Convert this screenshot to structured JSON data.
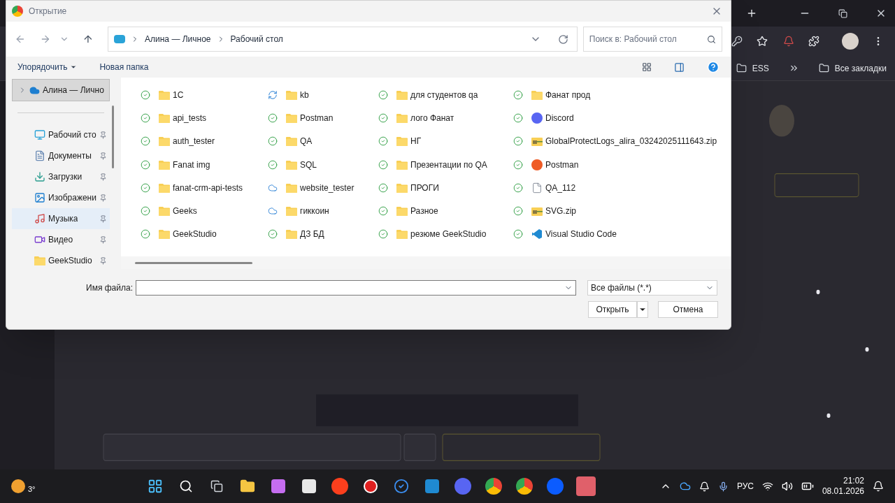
{
  "dialog": {
    "title": "Открытие",
    "breadcrumb": [
      "Алина — Личное",
      "Рабочий стол"
    ],
    "search_placeholder": "Поиск в: Рабочий стол",
    "toolbar": [
      "Упорядочить",
      "Новая папка"
    ],
    "sidebar": {
      "root": {
        "label": "Алина — Лично",
        "selected": true
      },
      "items": [
        {
          "label": "Рабочий сто",
          "kind": "desktop",
          "selected": false
        },
        {
          "label": "Документы",
          "kind": "documents",
          "selected": false
        },
        {
          "label": "Загрузки",
          "kind": "downloads",
          "selected": false
        },
        {
          "label": "Изображени",
          "kind": "pictures",
          "selected": false
        },
        {
          "label": "Музыка",
          "kind": "music",
          "selected": true
        },
        {
          "label": "Видео",
          "kind": "video",
          "selected": false
        },
        {
          "label": "GeekStudio",
          "kind": "folder",
          "selected": false
        }
      ]
    },
    "files": [
      [
        {
          "name": "1С",
          "sync": {
            "kind": "synced"
          },
          "kind": "folder"
        },
        {
          "name": "api_tests",
          "sync": {
            "kind": "synced"
          },
          "kind": "folder"
        },
        {
          "name": "auth_tester",
          "sync": {
            "kind": "synced"
          },
          "kind": "folder"
        },
        {
          "name": "Fanat img",
          "sync": {
            "kind": "synced"
          },
          "kind": "folder"
        },
        {
          "name": "fanat-crm-api-tests",
          "sync": {
            "kind": "synced"
          },
          "kind": "folder"
        },
        {
          "name": "Geeks",
          "sync": {
            "kind": "synced"
          },
          "kind": "folder"
        },
        {
          "name": "GeekStudio",
          "sync": {
            "kind": "synced"
          },
          "kind": "folder"
        }
      ],
      [
        {
          "name": "kb",
          "sync": {
            "kind": "syncing"
          },
          "kind": "folder"
        },
        {
          "name": "Postman",
          "sync": {
            "kind": "synced"
          },
          "kind": "folder"
        },
        {
          "name": "QA",
          "sync": {
            "kind": "synced"
          },
          "kind": "folder"
        },
        {
          "name": "SQL",
          "sync": {
            "kind": "synced"
          },
          "kind": "folder"
        },
        {
          "name": "website_tester",
          "sync": {
            "kind": "cloud"
          },
          "kind": "folder"
        },
        {
          "name": "гиккоин",
          "sync": {
            "kind": "cloud"
          },
          "kind": "folder"
        },
        {
          "name": "ДЗ БД",
          "sync": {
            "kind": "synced"
          },
          "kind": "folder"
        }
      ],
      [
        {
          "name": "для студентов qa",
          "sync": {
            "kind": "synced"
          },
          "kind": "folder"
        },
        {
          "name": "лого Фанат",
          "sync": {
            "kind": "synced"
          },
          "kind": "folder"
        },
        {
          "name": "НГ",
          "sync": {
            "kind": "synced"
          },
          "kind": "folder"
        },
        {
          "name": "Презентации  по QA",
          "sync": {
            "kind": "synced"
          },
          "kind": "folder"
        },
        {
          "name": "ПРОГИ",
          "sync": {
            "kind": "synced"
          },
          "kind": "folder"
        },
        {
          "name": "Разное",
          "sync": {
            "kind": "synced"
          },
          "kind": "folder"
        },
        {
          "name": "резюме GeekStudio",
          "sync": {
            "kind": "synced"
          },
          "kind": "folder"
        }
      ],
      [
        {
          "name": "Фанат прод",
          "sync": {
            "kind": "synced"
          },
          "kind": "folder"
        },
        {
          "name": "Discord",
          "sync": {
            "kind": "synced"
          },
          "kind": "discord"
        },
        {
          "name": "GlobalProtectLogs_alira_03242025111643.zip",
          "sync": {
            "kind": "synced"
          },
          "kind": "zip"
        },
        {
          "name": "Postman",
          "sync": {
            "kind": "synced"
          },
          "kind": "postman"
        },
        {
          "name": "QA_112",
          "sync": {
            "kind": "synced"
          },
          "kind": "document"
        },
        {
          "name": "SVG.zip",
          "sync": {
            "kind": "synced"
          },
          "kind": "zip"
        },
        {
          "name": "Visual Studio Code",
          "sync": {
            "kind": "synced"
          },
          "kind": "vscode"
        }
      ]
    ],
    "filename_label": "Имя файла:",
    "filter": "Все файлы (*.*)",
    "open": "Открыть",
    "cancel": "Отмена"
  },
  "browser": {
    "bookmarks": [
      "ESS",
      "Все закладки"
    ]
  },
  "taskbar": {
    "weather": "3°",
    "language": "РУС",
    "time": "21:02",
    "date": "08.01.2026"
  }
}
